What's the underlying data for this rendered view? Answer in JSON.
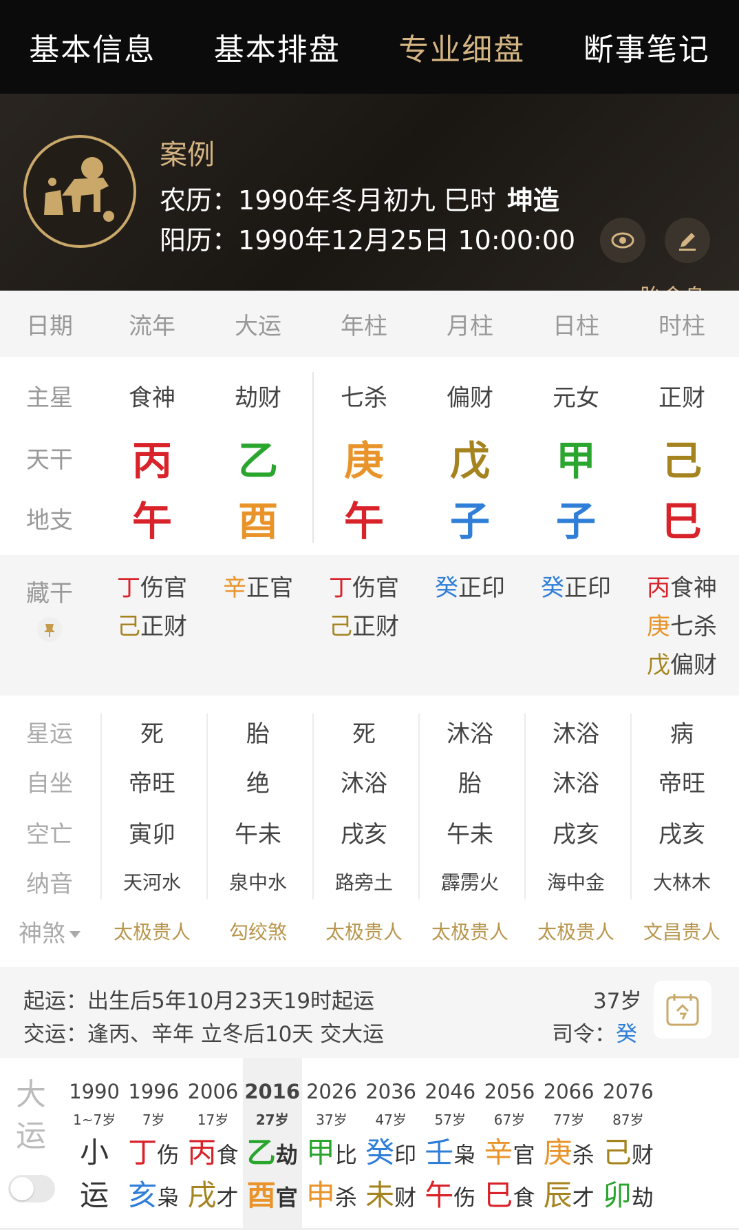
{
  "nav": {
    "tabs": [
      {
        "label": "基本信息"
      },
      {
        "label": "基本排盘"
      },
      {
        "label": "专业细盘"
      },
      {
        "label": "断事笔记"
      }
    ],
    "active_index": 2
  },
  "header": {
    "case_label": "案例",
    "lunar_label": "农历：",
    "lunar_value": "1990年冬月初九 巳时",
    "gender": "坤造",
    "solar_label": "阳历：",
    "solar_value": "1990年12月25日 10:00:00",
    "taiming_label": "胎命身",
    "taiming_toggle_on": false,
    "avatar_icon": "horse-zodiac-icon"
  },
  "columns": [
    "日期",
    "流年",
    "大运",
    "年柱",
    "月柱",
    "日柱",
    "时柱"
  ],
  "rows": {
    "main_star": {
      "label": "主星",
      "values": [
        "食神",
        "劫财",
        "七杀",
        "偏财",
        "元女",
        "正财"
      ]
    },
    "tiangan": {
      "label": "天干",
      "values": [
        "丙",
        "乙",
        "庚",
        "戊",
        "甲",
        "己"
      ],
      "colors": [
        "#d9232a",
        "#2aa52e",
        "#e8942b",
        "#a58420",
        "#2aa52e",
        "#a58420"
      ]
    },
    "dizhi": {
      "label": "地支",
      "values": [
        "午",
        "酉",
        "午",
        "子",
        "子",
        "巳"
      ],
      "colors": [
        "#d9232a",
        "#e8942b",
        "#d9232a",
        "#2f7ed8",
        "#2f7ed8",
        "#d9232a"
      ]
    }
  },
  "hidden_stems": {
    "label": "藏干",
    "columns": [
      [
        {
          "gan": "丁",
          "god": "伤官",
          "color": "#d9232a"
        },
        {
          "gan": "己",
          "god": "正财",
          "color": "#a58420"
        }
      ],
      [
        {
          "gan": "辛",
          "god": "正官",
          "color": "#e8942b"
        }
      ],
      [
        {
          "gan": "丁",
          "god": "伤官",
          "color": "#d9232a"
        },
        {
          "gan": "己",
          "god": "正财",
          "color": "#a58420"
        }
      ],
      [
        {
          "gan": "癸",
          "god": "正印",
          "color": "#2f7ed8"
        }
      ],
      [
        {
          "gan": "癸",
          "god": "正印",
          "color": "#2f7ed8"
        }
      ],
      [
        {
          "gan": "丙",
          "god": "食神",
          "color": "#d9232a"
        },
        {
          "gan": "庚",
          "god": "七杀",
          "color": "#e8942b"
        },
        {
          "gan": "戊",
          "god": "偏财",
          "color": "#a58420"
        }
      ]
    ]
  },
  "star_rows": [
    {
      "label": "星运",
      "values": [
        "死",
        "胎",
        "死",
        "沐浴",
        "沐浴",
        "病"
      ]
    },
    {
      "label": "自坐",
      "values": [
        "帝旺",
        "绝",
        "沐浴",
        "胎",
        "沐浴",
        "帝旺"
      ]
    },
    {
      "label": "空亡",
      "values": [
        "寅卯",
        "午未",
        "戌亥",
        "午未",
        "戌亥",
        "戌亥"
      ]
    },
    {
      "label": "纳音",
      "values": [
        "天河水",
        "泉中水",
        "路旁土",
        "霹雳火",
        "海中金",
        "大林木"
      ]
    }
  ],
  "shensha": {
    "label": "神煞",
    "values": [
      "太极贵人",
      "勾绞煞",
      "太极贵人",
      "太极贵人",
      "太极贵人",
      "文昌贵人"
    ]
  },
  "qiyun": {
    "start_label": "起运：",
    "start_value": "出生后5年10月23天19时起运",
    "change_label": "交运：",
    "change_value": "逢丙、辛年 立冬后10天 交大运",
    "age": "37岁",
    "siling_label": "司令：",
    "siling_value": "癸"
  },
  "dayun": {
    "label_line1": "大",
    "label_line2": "运",
    "toggle_on": false,
    "active_index": 3,
    "items": [
      {
        "year": "1990",
        "age": "1~7岁",
        "g1": "小",
        "g1c": "#333333",
        "t1": "",
        "g2": "运",
        "g2c": "#333333",
        "t2": ""
      },
      {
        "year": "1996",
        "age": "7岁",
        "g1": "丁",
        "g1c": "#d9232a",
        "t1": "伤",
        "g2": "亥",
        "g2c": "#2f7ed8",
        "t2": "枭"
      },
      {
        "year": "2006",
        "age": "17岁",
        "g1": "丙",
        "g1c": "#d9232a",
        "t1": "食",
        "g2": "戌",
        "g2c": "#a58420",
        "t2": "才"
      },
      {
        "year": "2016",
        "age": "27岁",
        "g1": "乙",
        "g1c": "#2aa52e",
        "t1": "劫",
        "g2": "酉",
        "g2c": "#e8942b",
        "t2": "官"
      },
      {
        "year": "2026",
        "age": "37岁",
        "g1": "甲",
        "g1c": "#2aa52e",
        "t1": "比",
        "g2": "申",
        "g2c": "#e8942b",
        "t2": "杀"
      },
      {
        "year": "2036",
        "age": "47岁",
        "g1": "癸",
        "g1c": "#2f7ed8",
        "t1": "印",
        "g2": "未",
        "g2c": "#a58420",
        "t2": "财"
      },
      {
        "year": "2046",
        "age": "57岁",
        "g1": "壬",
        "g1c": "#2f7ed8",
        "t1": "枭",
        "g2": "午",
        "g2c": "#d9232a",
        "t2": "伤"
      },
      {
        "year": "2056",
        "age": "67岁",
        "g1": "辛",
        "g1c": "#e8942b",
        "t1": "官",
        "g2": "巳",
        "g2c": "#d9232a",
        "t2": "食"
      },
      {
        "year": "2066",
        "age": "77岁",
        "g1": "庚",
        "g1c": "#e8942b",
        "t1": "杀",
        "g2": "辰",
        "g2c": "#a58420",
        "t2": "才"
      },
      {
        "year": "2076",
        "age": "87岁",
        "g1": "己",
        "g1c": "#a58420",
        "t1": "财",
        "g2": "卯",
        "g2c": "#2aa52e",
        "t2": "劫"
      }
    ]
  },
  "icons": {
    "eye": "eye-icon",
    "edit": "pencil-icon",
    "calendar": "calendar-icon",
    "pin": "pin-icon"
  },
  "colors": {
    "accent": "#d4b483",
    "nav_bg": "#0b0b0b",
    "header_bg": "#1f1a15"
  }
}
